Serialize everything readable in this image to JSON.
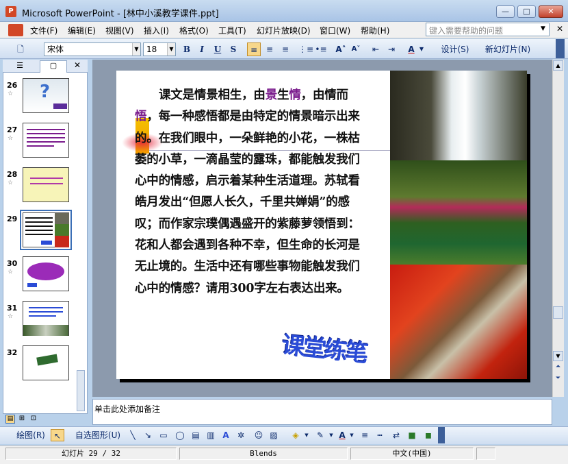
{
  "window": {
    "title": "Microsoft PowerPoint - [林中小溪教学课件.ppt]",
    "minimize": "—",
    "maximize": "□",
    "close": "✕"
  },
  "menu": {
    "items": [
      "文件(F)",
      "编辑(E)",
      "视图(V)",
      "插入(I)",
      "格式(O)",
      "工具(T)",
      "幻灯片放映(D)",
      "窗口(W)",
      "帮助(H)"
    ],
    "help_placeholder": "键入需要帮助的问题"
  },
  "toolbar": {
    "font_name": "宋体",
    "font_size": "18",
    "bold": "B",
    "italic": "I",
    "underline": "U",
    "shadow": "S",
    "design_label": "设计(S)",
    "new_slide_label": "新幻灯片(N)"
  },
  "slide_pane": {
    "thumbnails": [
      {
        "number": "26",
        "star": "☆"
      },
      {
        "number": "27",
        "star": "☆"
      },
      {
        "number": "28",
        "star": "☆"
      },
      {
        "number": "29",
        "star": "☆"
      },
      {
        "number": "30",
        "star": "☆"
      },
      {
        "number": "31",
        "star": "☆"
      },
      {
        "number": "32",
        "star": ""
      }
    ],
    "selected": "29"
  },
  "slide": {
    "text_parts": {
      "p1": "课文是情景相生，由",
      "h1": "景",
      "p2": "生",
      "h2": "情",
      "p3": "，由情而",
      "h3": "悟",
      "p4": "，每一种感悟都是由特定的情景暗示出来的。在我们眼中，一朵鲜艳的小花，一株枯萎的小草，一滴晶莹的露珠，都能触发我们心中的情感，启示着某种生活道理。苏轼看皓月发出“但愿人长久，千里共婵娟”的感叹；而作家宗璞偶遇盛开的紫藤萝领悟到：花和人都会遇到各种不幸，但生命的长河是无止境的。生活中还有哪些事物能触发我们心中的情感？请用300字左右表达出来。"
    },
    "wordart": "课堂练笔",
    "highlight_color": "#7a1b8c"
  },
  "notes": {
    "placeholder": "单击此处添加备注"
  },
  "drawing_toolbar": {
    "draw_label": "绘图(R)",
    "autoshapes_label": "自选图形(U)"
  },
  "status": {
    "slide_info": "幻灯片 29 / 32",
    "design": "Blends",
    "language": "中文(中国)"
  }
}
